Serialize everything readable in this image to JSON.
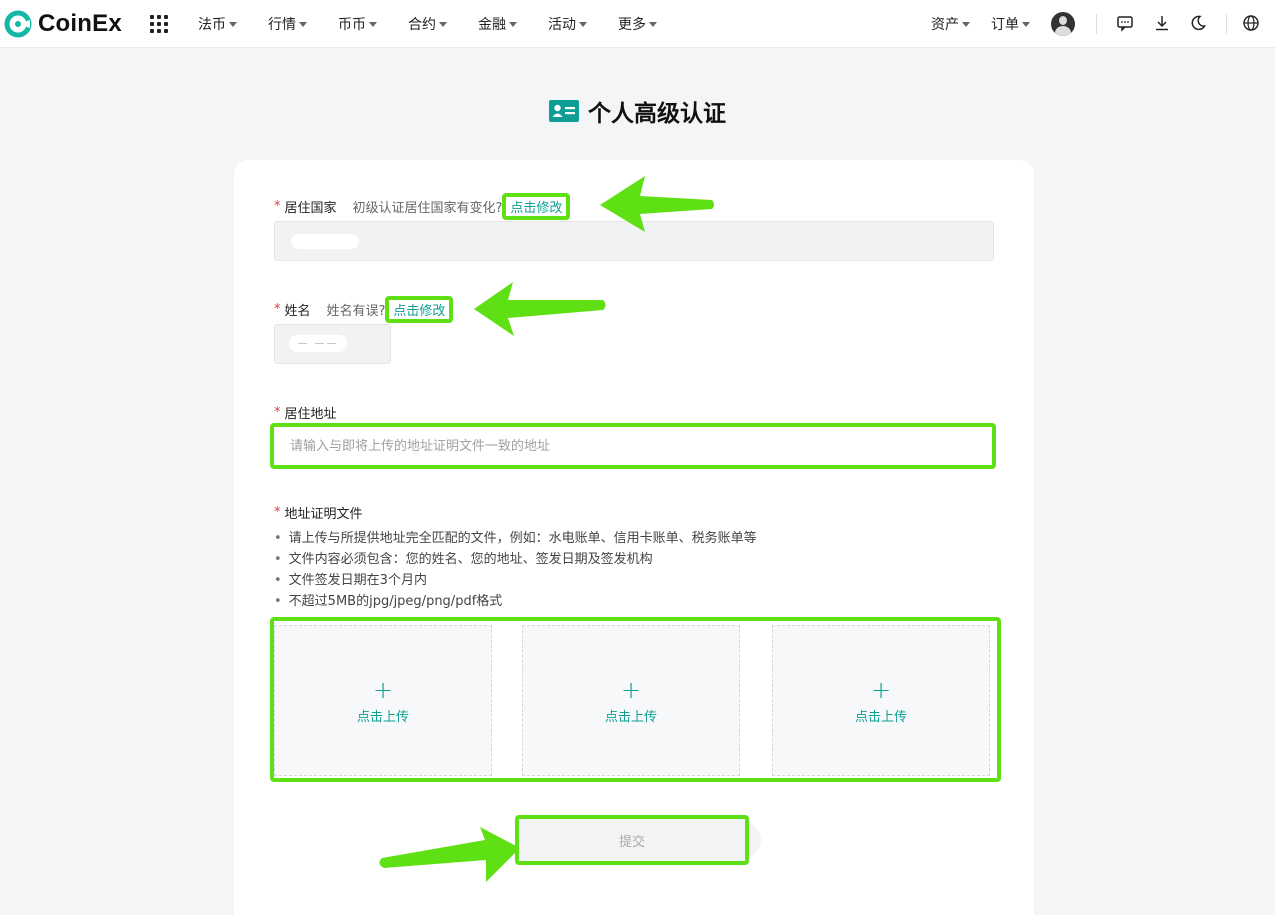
{
  "brand": {
    "name": "CoinEx",
    "accent": "#0e9e93",
    "highlight": "#5fe014"
  },
  "nav": {
    "items": [
      {
        "label": "法币"
      },
      {
        "label": "行情"
      },
      {
        "label": "币币"
      },
      {
        "label": "合约"
      },
      {
        "label": "金融"
      },
      {
        "label": "活动"
      },
      {
        "label": "更多"
      }
    ],
    "right": {
      "assets": "资产",
      "orders": "订单"
    },
    "icons": [
      "apps-grid-icon",
      "avatar",
      "message-icon",
      "download-icon",
      "moon-icon",
      "globe-icon"
    ]
  },
  "page": {
    "title": "个人高级认证",
    "title_icon": "id-card-icon"
  },
  "form": {
    "country": {
      "required_mark": "*",
      "label": "居住国家",
      "hint": "初级认证居住国家有变化?",
      "link": "点击修改"
    },
    "name": {
      "required_mark": "*",
      "label": "姓名",
      "hint": "姓名有误?",
      "link": "点击修改"
    },
    "address": {
      "required_mark": "*",
      "label": "居住地址",
      "placeholder": "请输入与即将上传的地址证明文件一致的地址"
    },
    "proof": {
      "required_mark": "*",
      "label": "地址证明文件",
      "bullets": [
        "请上传与所提供地址完全匹配的文件，例如：水电账单、信用卡账单、税务账单等",
        "文件内容必须包含：您的姓名、您的地址、签发日期及签发机构",
        "文件签发日期在3个月内",
        "不超过5MB的jpg/jpeg/png/pdf格式"
      ],
      "uploads": [
        {
          "plus": "+",
          "label": "点击上传"
        },
        {
          "plus": "+",
          "label": "点击上传"
        },
        {
          "plus": "+",
          "label": "点击上传"
        }
      ]
    },
    "submit_label": "提交"
  }
}
